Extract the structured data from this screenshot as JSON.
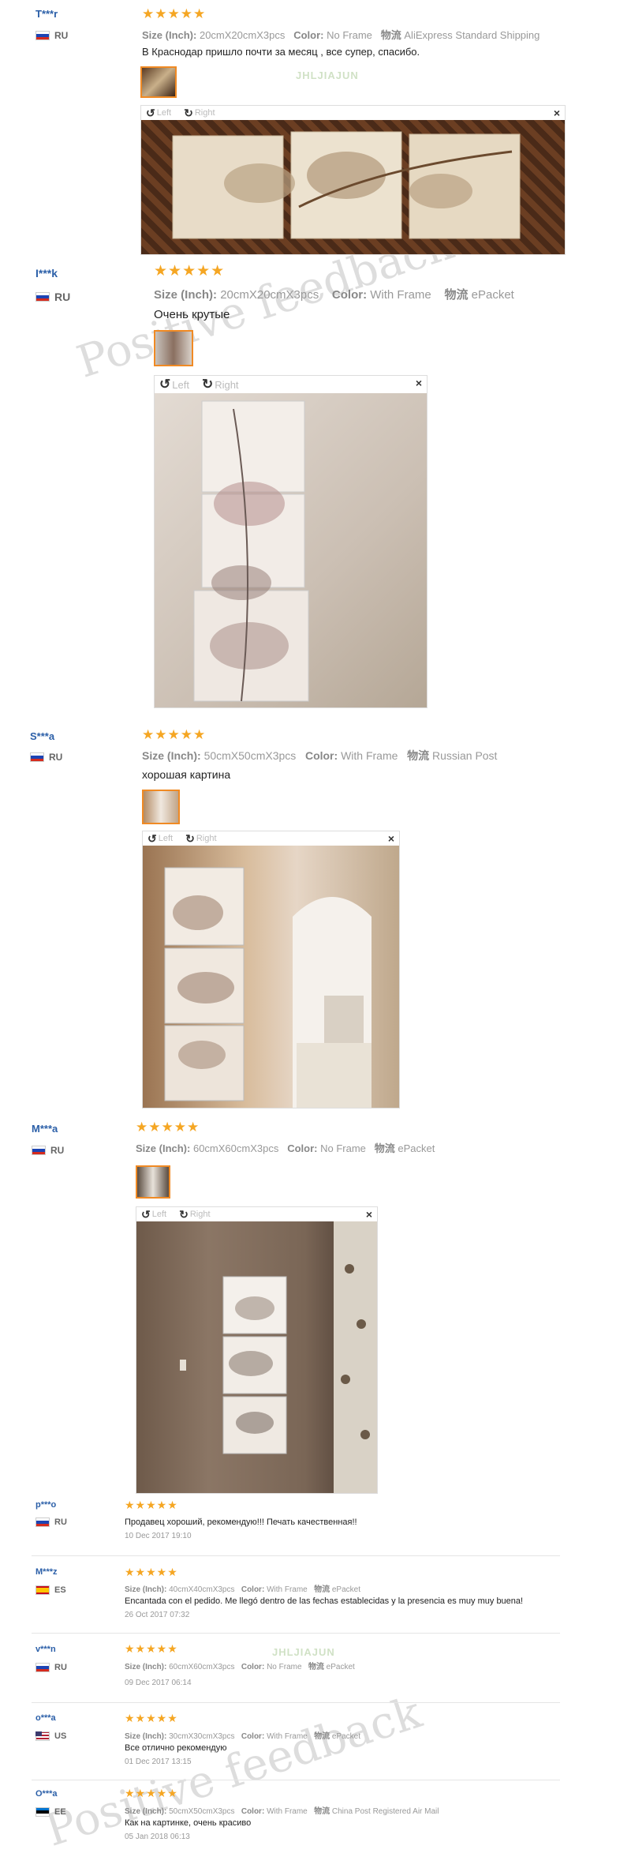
{
  "watermarks": {
    "main": "Positive feedback",
    "brand": "JHLJIAJUN"
  },
  "labels": {
    "size": "Size (Inch):",
    "color": "Color:",
    "ship": "物流",
    "left": "Left",
    "right": "Right",
    "close": "×"
  },
  "stars": "★★★★★",
  "reviews": [
    {
      "user": "T***r",
      "country": "RU",
      "size": "20cmX20cmX3pcs",
      "color": "No Frame",
      "shipping": "AliExpress Standard Shipping",
      "text": "В Краснодар пришло почти за месяц , все супер, спасибо."
    },
    {
      "user": "I***k",
      "country": "RU",
      "size": "20cmX20cmX3pcs",
      "color": "With Frame",
      "shipping": "ePacket",
      "text": "Очень крутые"
    },
    {
      "user": "S***a",
      "country": "RU",
      "size": "50cmX50cmX3pcs",
      "color": "With Frame",
      "shipping": "Russian Post",
      "text": "хорошая картина"
    },
    {
      "user": "M***a",
      "country": "RU",
      "size": "60cmX60cmX3pcs",
      "color": "No Frame",
      "shipping": "ePacket",
      "text": ""
    },
    {
      "user": "p***o",
      "country": "RU",
      "text": "Продавец хороший, рекомендую!!! Печать качественная!!",
      "date": "10 Dec 2017 19:10"
    },
    {
      "user": "M***z",
      "country": "ES",
      "size": "40cmX40cmX3pcs",
      "color": "With Frame",
      "shipping": "ePacket",
      "text": "Encantada con el pedido. Me llegó dentro de las fechas establecidas y la presencia es muy muy buena!",
      "date": "26 Oct 2017 07:32"
    },
    {
      "user": "v***n",
      "country": "RU",
      "size": "60cmX60cmX3pcs",
      "color": "No Frame",
      "shipping": "ePacket",
      "text": "",
      "date": "09 Dec 2017 06:14"
    },
    {
      "user": "o***a",
      "country": "US",
      "size": "30cmX30cmX3pcs",
      "color": "With Frame",
      "shipping": "ePacket",
      "text": "Все отлично рекомендую",
      "date": "01 Dec 2017 13:15"
    },
    {
      "user": "O***a",
      "country": "EE",
      "size": "50cmX50cmX3pcs",
      "color": "With Frame",
      "shipping": "China Post Registered Air Mail",
      "text": "Как на картинке, очень красиво",
      "date": "05 Jan 2018 06:13"
    }
  ]
}
